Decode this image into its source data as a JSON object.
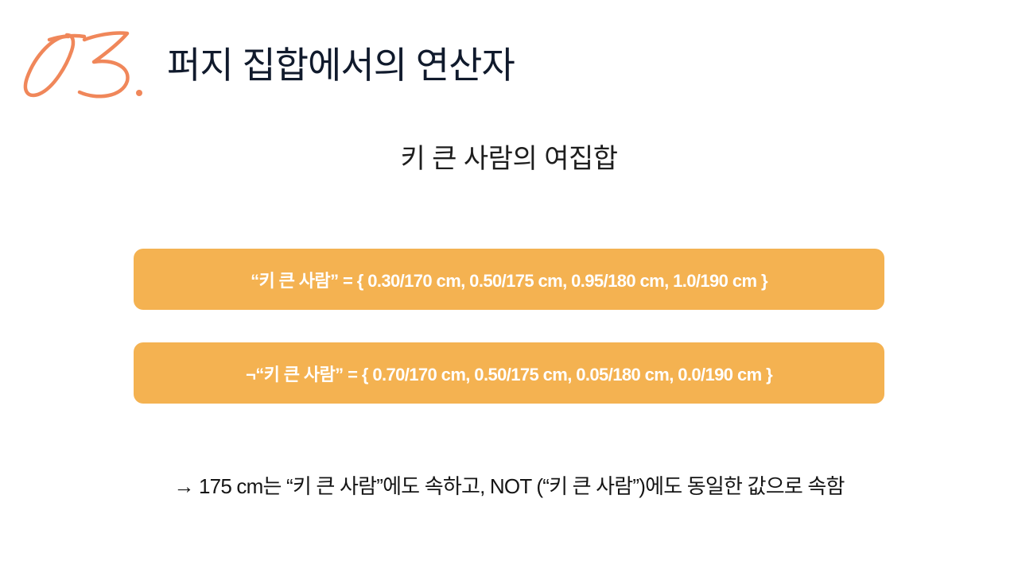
{
  "section": {
    "number": "03.",
    "title": "퍼지 집합에서의 연산자"
  },
  "subtitle": "키 큰 사람의 여집합",
  "sets": [
    {
      "label": "“키 큰 사람” = { 0.30/170 cm, 0.50/175 cm, 0.95/180 cm, 1.0/190 cm }"
    },
    {
      "label": "¬“키 큰 사람” = { 0.70/170 cm, 0.50/175 cm, 0.05/180 cm, 0.0/190 cm }"
    }
  ],
  "note": "→ 175 cm는 “키 큰 사람”에도 속하고, NOT (“키 큰 사람”)에도 동일한 값으로 속함",
  "colors": {
    "accent": "#f0875a",
    "box": "#f4b251",
    "title": "#101a2c",
    "box_text": "#ffffff"
  }
}
